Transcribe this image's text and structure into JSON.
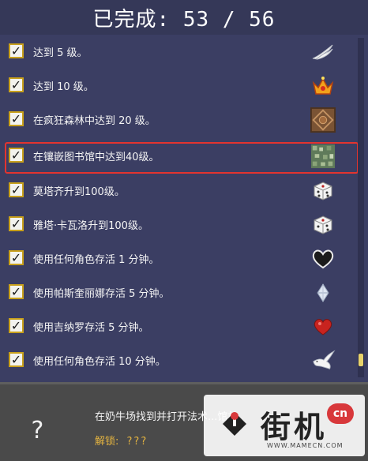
{
  "header": {
    "title": "已完成: 53 / 56"
  },
  "achievements": [
    {
      "label": "达到 5 级。",
      "icon": "wings-icon",
      "checked": true
    },
    {
      "label": "达到 10 级。",
      "icon": "crown-icon",
      "checked": true
    },
    {
      "label": "在疯狂森林中达到 20 级。",
      "icon": "wooden-crate-icon",
      "checked": true
    },
    {
      "label": "在镶嵌图书馆中达到40级。",
      "icon": "mosaic-tile-icon",
      "checked": true
    },
    {
      "label": "莫塔齐升到100级。",
      "icon": "dice-icon",
      "checked": true
    },
    {
      "label": "雅塔·卡瓦洛升到100级。",
      "icon": "dice-icon",
      "checked": true
    },
    {
      "label": "使用任何角色存活 1 分钟。",
      "icon": "dark-heart-icon",
      "checked": true
    },
    {
      "label": "使用帕斯奎丽娜存活 5 分钟。",
      "icon": "crystal-icon",
      "checked": true
    },
    {
      "label": "使用吉纳罗存活 5 分钟。",
      "icon": "red-heart-icon",
      "checked": true
    },
    {
      "label": "使用任何角色存活 10 分钟。",
      "icon": "dove-icon",
      "checked": true
    }
  ],
  "footer": {
    "question_mark": "?",
    "description": "在奶牛场找到并打开法术...馆林",
    "unlock_label": "解锁:",
    "unlock_value": "???"
  },
  "watermark": {
    "brand": "街机",
    "badge": "cn",
    "url": "WWW.MAMECN.COM"
  },
  "colors": {
    "background": "#3b3e63",
    "highlight_border": "#e3342f",
    "checkbox_border": "#c9a11c",
    "footer_bg": "#4a4a4a",
    "unlock_color": "#e3b340"
  }
}
